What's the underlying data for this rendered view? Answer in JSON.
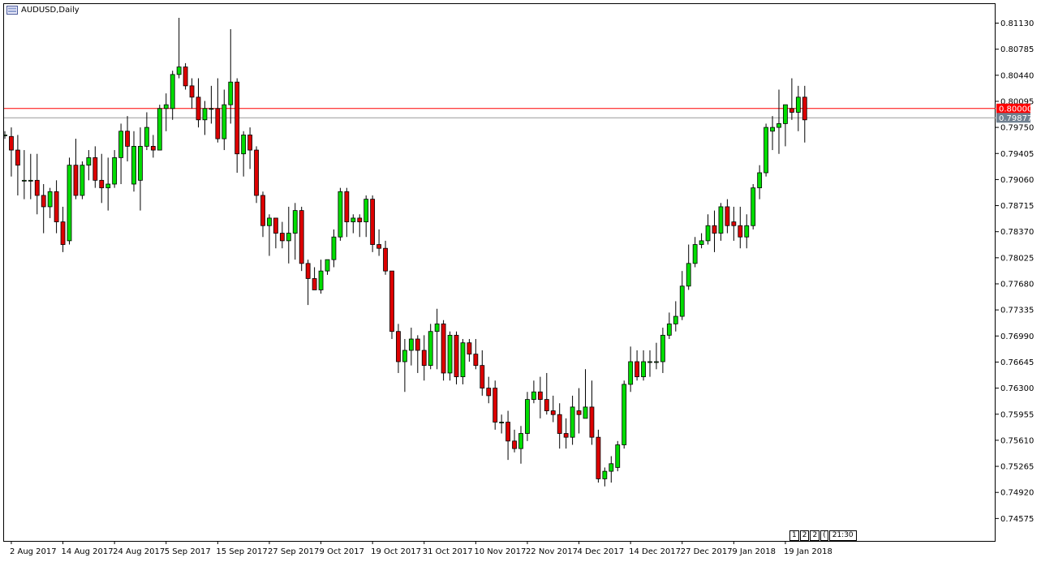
{
  "window": {
    "title": "AUDUSD,Daily"
  },
  "colors": {
    "bull": "#00dd00",
    "bear": "#dd0000",
    "wick": "#000000",
    "resistance_line": "#ff0000",
    "resistance_label_bg": "#ff0000",
    "price_line": "#999999",
    "price_label_bg": "#708090"
  },
  "navigation": {
    "scroll_buttons": [
      "1",
      "2",
      "2",
      "("
    ],
    "time_label": "21:30"
  },
  "chart_data": {
    "type": "candlestick",
    "symbol": "AUDUSD",
    "timeframe": "Daily",
    "ylim": [
      0.744,
      0.8145
    ],
    "y_ticks": [
      "0.81130",
      "0.80785",
      "0.80440",
      "0.80095",
      "0.79750",
      "0.79405",
      "0.79060",
      "0.78715",
      "0.78370",
      "0.78025",
      "0.77680",
      "0.77335",
      "0.76990",
      "0.76645",
      "0.76300",
      "0.75955",
      "0.75610",
      "0.75265",
      "0.74920",
      "0.74575"
    ],
    "x_labels": [
      {
        "index": 1,
        "label": "2 Aug 2017"
      },
      {
        "index": 9,
        "label": "14 Aug 2017"
      },
      {
        "index": 17,
        "label": "24 Aug 2017"
      },
      {
        "index": 25,
        "label": "5 Sep 2017"
      },
      {
        "index": 33,
        "label": "15 Sep 2017"
      },
      {
        "index": 41,
        "label": "27 Sep 2017"
      },
      {
        "index": 49,
        "label": "9 Oct 2017"
      },
      {
        "index": 57,
        "label": "19 Oct 2017"
      },
      {
        "index": 65,
        "label": "31 Oct 2017"
      },
      {
        "index": 73,
        "label": "10 Nov 2017"
      },
      {
        "index": 81,
        "label": "22 Nov 2017"
      },
      {
        "index": 89,
        "label": "4 Dec 2017"
      },
      {
        "index": 97,
        "label": "14 Dec 2017"
      },
      {
        "index": 105,
        "label": "27 Dec 2017"
      },
      {
        "index": 113,
        "label": "9 Jan 2018"
      },
      {
        "index": 121,
        "label": "19 Jan 2018"
      }
    ],
    "horizontal_lines": [
      {
        "name": "resistance",
        "value": 0.8,
        "label": "0.80000"
      },
      {
        "name": "current_price",
        "value": 0.79877,
        "label": "0.79877"
      }
    ],
    "candles": [
      {
        "o": 0.7965,
        "h": 0.797,
        "l": 0.796,
        "c": 0.7965
      },
      {
        "o": 0.7963,
        "h": 0.7975,
        "l": 0.791,
        "c": 0.7945
      },
      {
        "o": 0.7945,
        "h": 0.7965,
        "l": 0.7885,
        "c": 0.7925
      },
      {
        "o": 0.7905,
        "h": 0.7945,
        "l": 0.788,
        "c": 0.7905
      },
      {
        "o": 0.7905,
        "h": 0.794,
        "l": 0.788,
        "c": 0.7905
      },
      {
        "o": 0.7905,
        "h": 0.794,
        "l": 0.786,
        "c": 0.7885
      },
      {
        "o": 0.7885,
        "h": 0.79,
        "l": 0.7835,
        "c": 0.787
      },
      {
        "o": 0.787,
        "h": 0.7895,
        "l": 0.7855,
        "c": 0.789
      },
      {
        "o": 0.789,
        "h": 0.7905,
        "l": 0.7835,
        "c": 0.785
      },
      {
        "o": 0.785,
        "h": 0.787,
        "l": 0.781,
        "c": 0.782
      },
      {
        "o": 0.7825,
        "h": 0.7935,
        "l": 0.782,
        "c": 0.7925
      },
      {
        "o": 0.7925,
        "h": 0.796,
        "l": 0.788,
        "c": 0.7885
      },
      {
        "o": 0.7885,
        "h": 0.793,
        "l": 0.788,
        "c": 0.7925
      },
      {
        "o": 0.7925,
        "h": 0.7945,
        "l": 0.7905,
        "c": 0.7935
      },
      {
        "o": 0.7935,
        "h": 0.795,
        "l": 0.7895,
        "c": 0.7905
      },
      {
        "o": 0.7905,
        "h": 0.794,
        "l": 0.7875,
        "c": 0.7895
      },
      {
        "o": 0.7895,
        "h": 0.7935,
        "l": 0.7865,
        "c": 0.79
      },
      {
        "o": 0.79,
        "h": 0.7945,
        "l": 0.7895,
        "c": 0.7935
      },
      {
        "o": 0.7935,
        "h": 0.798,
        "l": 0.79,
        "c": 0.797
      },
      {
        "o": 0.797,
        "h": 0.799,
        "l": 0.793,
        "c": 0.795
      },
      {
        "o": 0.79,
        "h": 0.797,
        "l": 0.789,
        "c": 0.795
      },
      {
        "o": 0.7905,
        "h": 0.7975,
        "l": 0.7865,
        "c": 0.795
      },
      {
        "o": 0.795,
        "h": 0.7995,
        "l": 0.7945,
        "c": 0.7975
      },
      {
        "o": 0.795,
        "h": 0.7965,
        "l": 0.7935,
        "c": 0.7945
      },
      {
        "o": 0.7945,
        "h": 0.8005,
        "l": 0.7945,
        "c": 0.8
      },
      {
        "o": 0.8,
        "h": 0.802,
        "l": 0.797,
        "c": 0.8005
      },
      {
        "o": 0.8,
        "h": 0.805,
        "l": 0.7985,
        "c": 0.8045
      },
      {
        "o": 0.8045,
        "h": 0.812,
        "l": 0.804,
        "c": 0.8055
      },
      {
        "o": 0.8055,
        "h": 0.806,
        "l": 0.8025,
        "c": 0.803
      },
      {
        "o": 0.803,
        "h": 0.804,
        "l": 0.8,
        "c": 0.8015
      },
      {
        "o": 0.8015,
        "h": 0.804,
        "l": 0.7975,
        "c": 0.7985
      },
      {
        "o": 0.7985,
        "h": 0.801,
        "l": 0.7965,
        "c": 0.8
      },
      {
        "o": 0.8,
        "h": 0.803,
        "l": 0.798,
        "c": 0.8
      },
      {
        "o": 0.8,
        "h": 0.804,
        "l": 0.7955,
        "c": 0.796
      },
      {
        "o": 0.796,
        "h": 0.8025,
        "l": 0.7945,
        "c": 0.8005
      },
      {
        "o": 0.8005,
        "h": 0.8105,
        "l": 0.798,
        "c": 0.8035
      },
      {
        "o": 0.8035,
        "h": 0.804,
        "l": 0.7915,
        "c": 0.794
      },
      {
        "o": 0.794,
        "h": 0.797,
        "l": 0.791,
        "c": 0.7965
      },
      {
        "o": 0.7965,
        "h": 0.7975,
        "l": 0.792,
        "c": 0.7945
      },
      {
        "o": 0.7945,
        "h": 0.795,
        "l": 0.7875,
        "c": 0.7885
      },
      {
        "o": 0.7885,
        "h": 0.789,
        "l": 0.783,
        "c": 0.7845
      },
      {
        "o": 0.7845,
        "h": 0.786,
        "l": 0.7805,
        "c": 0.7855
      },
      {
        "o": 0.7855,
        "h": 0.7855,
        "l": 0.7815,
        "c": 0.7835
      },
      {
        "o": 0.7835,
        "h": 0.785,
        "l": 0.7815,
        "c": 0.7825
      },
      {
        "o": 0.7825,
        "h": 0.787,
        "l": 0.7795,
        "c": 0.7835
      },
      {
        "o": 0.7835,
        "h": 0.7875,
        "l": 0.78,
        "c": 0.7865
      },
      {
        "o": 0.7865,
        "h": 0.787,
        "l": 0.7785,
        "c": 0.7795
      },
      {
        "o": 0.7795,
        "h": 0.78,
        "l": 0.774,
        "c": 0.7775
      },
      {
        "o": 0.7775,
        "h": 0.779,
        "l": 0.776,
        "c": 0.776
      },
      {
        "o": 0.776,
        "h": 0.78,
        "l": 0.7755,
        "c": 0.7785
      },
      {
        "o": 0.7785,
        "h": 0.78,
        "l": 0.778,
        "c": 0.78
      },
      {
        "o": 0.78,
        "h": 0.784,
        "l": 0.779,
        "c": 0.783
      },
      {
        "o": 0.783,
        "h": 0.7895,
        "l": 0.7825,
        "c": 0.789
      },
      {
        "o": 0.789,
        "h": 0.7895,
        "l": 0.783,
        "c": 0.785
      },
      {
        "o": 0.785,
        "h": 0.786,
        "l": 0.7835,
        "c": 0.7855
      },
      {
        "o": 0.7855,
        "h": 0.786,
        "l": 0.783,
        "c": 0.785
      },
      {
        "o": 0.785,
        "h": 0.7885,
        "l": 0.783,
        "c": 0.788
      },
      {
        "o": 0.788,
        "h": 0.7885,
        "l": 0.781,
        "c": 0.782
      },
      {
        "o": 0.782,
        "h": 0.784,
        "l": 0.7805,
        "c": 0.7815
      },
      {
        "o": 0.7815,
        "h": 0.7825,
        "l": 0.778,
        "c": 0.7785
      },
      {
        "o": 0.7785,
        "h": 0.7785,
        "l": 0.7695,
        "c": 0.7705
      },
      {
        "o": 0.7705,
        "h": 0.7715,
        "l": 0.765,
        "c": 0.7665
      },
      {
        "o": 0.7665,
        "h": 0.7695,
        "l": 0.7625,
        "c": 0.768
      },
      {
        "o": 0.768,
        "h": 0.771,
        "l": 0.766,
        "c": 0.7695
      },
      {
        "o": 0.7695,
        "h": 0.77,
        "l": 0.765,
        "c": 0.768
      },
      {
        "o": 0.768,
        "h": 0.77,
        "l": 0.764,
        "c": 0.766
      },
      {
        "o": 0.766,
        "h": 0.7715,
        "l": 0.7655,
        "c": 0.7705
      },
      {
        "o": 0.7705,
        "h": 0.7735,
        "l": 0.7655,
        "c": 0.7715
      },
      {
        "o": 0.7715,
        "h": 0.772,
        "l": 0.764,
        "c": 0.765
      },
      {
        "o": 0.765,
        "h": 0.7705,
        "l": 0.764,
        "c": 0.77
      },
      {
        "o": 0.77,
        "h": 0.7705,
        "l": 0.7635,
        "c": 0.7645
      },
      {
        "o": 0.7645,
        "h": 0.7695,
        "l": 0.7635,
        "c": 0.769
      },
      {
        "o": 0.769,
        "h": 0.7695,
        "l": 0.7665,
        "c": 0.7675
      },
      {
        "o": 0.7675,
        "h": 0.7695,
        "l": 0.7655,
        "c": 0.766
      },
      {
        "o": 0.766,
        "h": 0.768,
        "l": 0.762,
        "c": 0.763
      },
      {
        "o": 0.763,
        "h": 0.7645,
        "l": 0.761,
        "c": 0.762
      },
      {
        "o": 0.763,
        "h": 0.764,
        "l": 0.7575,
        "c": 0.7585
      },
      {
        "o": 0.7585,
        "h": 0.7595,
        "l": 0.757,
        "c": 0.7585
      },
      {
        "o": 0.7585,
        "h": 0.76,
        "l": 0.7535,
        "c": 0.756
      },
      {
        "o": 0.756,
        "h": 0.7575,
        "l": 0.7545,
        "c": 0.755
      },
      {
        "o": 0.755,
        "h": 0.758,
        "l": 0.753,
        "c": 0.757
      },
      {
        "o": 0.757,
        "h": 0.7625,
        "l": 0.756,
        "c": 0.7615
      },
      {
        "o": 0.7615,
        "h": 0.764,
        "l": 0.761,
        "c": 0.7625
      },
      {
        "o": 0.7625,
        "h": 0.7645,
        "l": 0.759,
        "c": 0.7615
      },
      {
        "o": 0.7615,
        "h": 0.765,
        "l": 0.7595,
        "c": 0.76
      },
      {
        "o": 0.76,
        "h": 0.762,
        "l": 0.7585,
        "c": 0.7595
      },
      {
        "o": 0.7595,
        "h": 0.761,
        "l": 0.755,
        "c": 0.757
      },
      {
        "o": 0.757,
        "h": 0.759,
        "l": 0.755,
        "c": 0.7565
      },
      {
        "o": 0.7565,
        "h": 0.762,
        "l": 0.7555,
        "c": 0.7605
      },
      {
        "o": 0.76,
        "h": 0.763,
        "l": 0.757,
        "c": 0.7595
      },
      {
        "o": 0.759,
        "h": 0.7655,
        "l": 0.759,
        "c": 0.7605
      },
      {
        "o": 0.7605,
        "h": 0.764,
        "l": 0.7555,
        "c": 0.7565
      },
      {
        "o": 0.7565,
        "h": 0.7575,
        "l": 0.7505,
        "c": 0.751
      },
      {
        "o": 0.751,
        "h": 0.7525,
        "l": 0.75,
        "c": 0.752
      },
      {
        "o": 0.752,
        "h": 0.754,
        "l": 0.7505,
        "c": 0.753
      },
      {
        "o": 0.7525,
        "h": 0.756,
        "l": 0.752,
        "c": 0.7555
      },
      {
        "o": 0.7555,
        "h": 0.764,
        "l": 0.755,
        "c": 0.7635
      },
      {
        "o": 0.7635,
        "h": 0.7685,
        "l": 0.7625,
        "c": 0.7665
      },
      {
        "o": 0.7665,
        "h": 0.768,
        "l": 0.764,
        "c": 0.7645
      },
      {
        "o": 0.7645,
        "h": 0.768,
        "l": 0.764,
        "c": 0.7665
      },
      {
        "o": 0.7665,
        "h": 0.768,
        "l": 0.7645,
        "c": 0.7665
      },
      {
        "o": 0.7665,
        "h": 0.769,
        "l": 0.7655,
        "c": 0.7665
      },
      {
        "o": 0.7665,
        "h": 0.771,
        "l": 0.765,
        "c": 0.77
      },
      {
        "o": 0.77,
        "h": 0.773,
        "l": 0.7695,
        "c": 0.7715
      },
      {
        "o": 0.7715,
        "h": 0.7745,
        "l": 0.7705,
        "c": 0.7725
      },
      {
        "o": 0.7725,
        "h": 0.7785,
        "l": 0.772,
        "c": 0.7765
      },
      {
        "o": 0.7765,
        "h": 0.782,
        "l": 0.776,
        "c": 0.7795
      },
      {
        "o": 0.7795,
        "h": 0.783,
        "l": 0.779,
        "c": 0.782
      },
      {
        "o": 0.782,
        "h": 0.7835,
        "l": 0.7815,
        "c": 0.7825
      },
      {
        "o": 0.7825,
        "h": 0.786,
        "l": 0.782,
        "c": 0.7845
      },
      {
        "o": 0.7845,
        "h": 0.7865,
        "l": 0.781,
        "c": 0.7835
      },
      {
        "o": 0.7835,
        "h": 0.7875,
        "l": 0.7825,
        "c": 0.787
      },
      {
        "o": 0.787,
        "h": 0.788,
        "l": 0.7835,
        "c": 0.7845
      },
      {
        "o": 0.785,
        "h": 0.787,
        "l": 0.7825,
        "c": 0.7845
      },
      {
        "o": 0.7845,
        "h": 0.787,
        "l": 0.7815,
        "c": 0.783
      },
      {
        "o": 0.783,
        "h": 0.786,
        "l": 0.7815,
        "c": 0.7845
      },
      {
        "o": 0.7845,
        "h": 0.79,
        "l": 0.784,
        "c": 0.7895
      },
      {
        "o": 0.7895,
        "h": 0.7925,
        "l": 0.788,
        "c": 0.7915
      },
      {
        "o": 0.7915,
        "h": 0.798,
        "l": 0.791,
        "c": 0.7975
      },
      {
        "o": 0.797,
        "h": 0.799,
        "l": 0.7945,
        "c": 0.7975
      },
      {
        "o": 0.7975,
        "h": 0.8025,
        "l": 0.794,
        "c": 0.798
      },
      {
        "o": 0.798,
        "h": 0.8005,
        "l": 0.795,
        "c": 0.8005
      },
      {
        "o": 0.8,
        "h": 0.804,
        "l": 0.7985,
        "c": 0.7995
      },
      {
        "o": 0.7995,
        "h": 0.803,
        "l": 0.797,
        "c": 0.8015
      },
      {
        "o": 0.8015,
        "h": 0.803,
        "l": 0.7955,
        "c": 0.7985
      }
    ]
  }
}
